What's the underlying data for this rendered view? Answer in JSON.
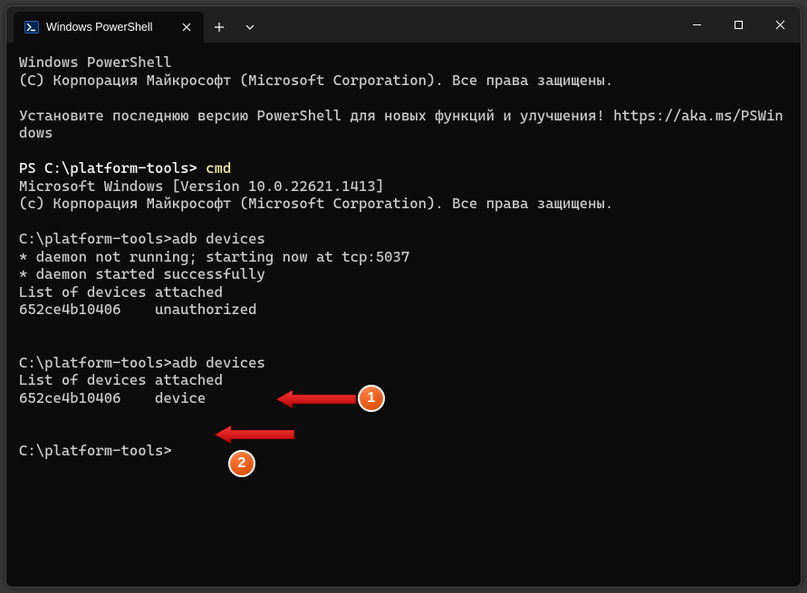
{
  "window": {
    "tab_title": "Windows PowerShell"
  },
  "terminal": {
    "lines": [
      {
        "segments": [
          {
            "t": "Windows PowerShell"
          }
        ]
      },
      {
        "segments": [
          {
            "t": "(C) Корпорация Майкрософт (Microsoft Corporation). Все права защищены."
          }
        ]
      },
      {
        "segments": [
          {
            "t": ""
          }
        ]
      },
      {
        "segments": [
          {
            "t": "Установите последнюю версию PowerShell для новых функций и улучшения! https://aka.ms/PSWindows"
          }
        ]
      },
      {
        "segments": [
          {
            "t": ""
          }
        ]
      },
      {
        "segments": [
          {
            "t": "PS C:\\platform-tools> ",
            "cls": "white"
          },
          {
            "t": "cmd",
            "cls": "yellow"
          }
        ]
      },
      {
        "segments": [
          {
            "t": "Microsoft Windows [Version 10.0.22621.1413]"
          }
        ]
      },
      {
        "segments": [
          {
            "t": "(c) Корпорация Майкрософт (Microsoft Corporation). Все права защищены."
          }
        ]
      },
      {
        "segments": [
          {
            "t": ""
          }
        ]
      },
      {
        "segments": [
          {
            "t": "C:\\platform-tools>adb devices"
          }
        ]
      },
      {
        "segments": [
          {
            "t": "* daemon not running; starting now at tcp:5037"
          }
        ]
      },
      {
        "segments": [
          {
            "t": "* daemon started successfully"
          }
        ]
      },
      {
        "segments": [
          {
            "t": "List of devices attached"
          }
        ]
      },
      {
        "segments": [
          {
            "t": "652ce4b10406    unauthorized"
          }
        ]
      },
      {
        "segments": [
          {
            "t": ""
          }
        ]
      },
      {
        "segments": [
          {
            "t": ""
          }
        ]
      },
      {
        "segments": [
          {
            "t": "C:\\platform-tools>adb devices"
          }
        ]
      },
      {
        "segments": [
          {
            "t": "List of devices attached"
          }
        ]
      },
      {
        "segments": [
          {
            "t": "652ce4b10406    device"
          }
        ]
      },
      {
        "segments": [
          {
            "t": ""
          }
        ]
      },
      {
        "segments": [
          {
            "t": ""
          }
        ]
      },
      {
        "segments": [
          {
            "t": "C:\\platform-tools>"
          }
        ]
      }
    ]
  },
  "callouts": {
    "badge1": "1",
    "badge2": "2"
  }
}
